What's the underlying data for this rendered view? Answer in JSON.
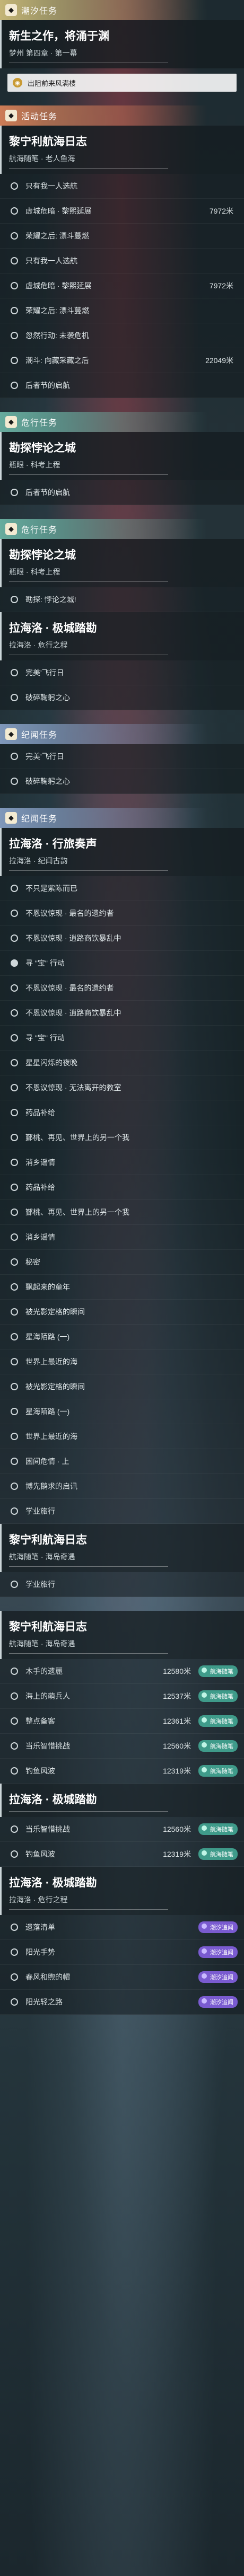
{
  "groups": [
    {
      "id": "g1",
      "header": "潮汐任务",
      "color": "#d6c47e",
      "icon": "tide-icon",
      "quests": [
        {
          "title": "新生之作，将涌于渊",
          "subtitle": "梦州 第四章 · 第一幕",
          "track_label": "出阻前来风满楼",
          "objectives": []
        }
      ]
    },
    {
      "id": "g2",
      "header": "活动任务",
      "color": "#e0855a",
      "icon": "event-icon",
      "quests": [
        {
          "title": "黎宁利航海日志",
          "subtitle": "航海随笔 · 老人鱼海",
          "objectives": [
            {
              "text": "只有我一人选航",
              "dist": "",
              "done": false,
              "tag": ""
            },
            {
              "text": "虚城危暗 · 黎熙延展",
              "dist": "7972米",
              "done": false,
              "tag": ""
            },
            {
              "text": "荣耀之后: 漂斗蔓燃",
              "dist": "",
              "done": false,
              "tag": ""
            }
          ]
        }
      ],
      "extra_objectives": [
        {
          "text": "只有我一人选航",
          "dist": "",
          "done": false,
          "tag": ""
        },
        {
          "text": "虚城危暗 · 黎熙延展",
          "dist": "7972米",
          "done": false,
          "tag": ""
        },
        {
          "text": "荣耀之后: 漂斗蔓燃",
          "dist": "",
          "done": false,
          "tag": ""
        },
        {
          "text": "忽然行动: 未袭危机",
          "dist": "",
          "done": false,
          "tag": ""
        },
        {
          "text": "潮斗: 向藏采藏之后",
          "dist": "22049米",
          "done": false,
          "tag": ""
        },
        {
          "text": "后者节的启航",
          "dist": "",
          "done": false,
          "tag": ""
        }
      ]
    },
    {
      "id": "g3",
      "header": "危行任务",
      "color": "#6fb9a9",
      "icon": "quest-icon",
      "quests": [
        {
          "title": "勘探悖论之城",
          "subtitle": "瓶眼 · 科考上程",
          "objectives": [
            {
              "text": "后者节的启航",
              "dist": "",
              "done": false,
              "tag": ""
            }
          ]
        }
      ]
    },
    {
      "id": "g4",
      "header": "危行任务",
      "color": "#6fb9a9",
      "icon": "quest-icon",
      "quests": [
        {
          "title": "勘探悖论之城",
          "subtitle": "瓶眼 · 科考上程",
          "objectives": [
            {
              "text": "勘探: 悖论之城!",
              "dist": "",
              "done": false,
              "tag": ""
            }
          ]
        },
        {
          "title": "拉海洛 · 极城踏勘",
          "subtitle": "拉海洛 · 危行之程",
          "objectives": [
            {
              "text": "完美'飞行日",
              "dist": "",
              "done": false,
              "tag": ""
            },
            {
              "text": "破碎鞠躬之心",
              "dist": "",
              "done": false,
              "tag": ""
            }
          ]
        }
      ]
    },
    {
      "id": "g5",
      "header": "纪闻任务",
      "color": "#8aa3c9",
      "icon": "record-icon",
      "quests": [],
      "extra_objectives": [
        {
          "text": "完美'飞行日",
          "dist": "",
          "done": false,
          "tag": ""
        },
        {
          "text": "破碎鞠躬之心",
          "dist": "",
          "done": false,
          "tag": ""
        }
      ]
    },
    {
      "id": "g6",
      "header": "纪闻任务",
      "color": "#8aa3c9",
      "icon": "record-icon",
      "quests": [
        {
          "title": "拉海洛 · 行旅奏声",
          "subtitle": "拉海洛 · 纪闻古韵",
          "objectives": [
            {
              "text": "不只是紫陈而已",
              "dist": "",
              "done": false,
              "tag": ""
            },
            {
              "text": "不恩议惊现 · 最名的遗约者",
              "dist": "",
              "done": false,
              "tag": ""
            },
            {
              "text": "不恩议惊现 · 逍路商饮暴乱中",
              "dist": "",
              "done": false,
              "tag": ""
            },
            {
              "text": "寻 \"宝\" 行动",
              "dist": "",
              "done": true,
              "tag": ""
            },
            {
              "text": "不恩议惊现 · 最名的遗约者",
              "dist": "",
              "done": false,
              "tag": ""
            },
            {
              "text": "不恩议惊现 · 逍路商饮暴乱中",
              "dist": "",
              "done": false,
              "tag": ""
            },
            {
              "text": "寻 \"宝\" 行动",
              "dist": "",
              "done": false,
              "tag": ""
            },
            {
              "text": "星星闪烁的夜晚",
              "dist": "",
              "done": false,
              "tag": ""
            },
            {
              "text": "不恩议惊现 · 无法离开的教室",
              "dist": "",
              "done": false,
              "tag": ""
            },
            {
              "text": "药品补给",
              "dist": "",
              "done": false,
              "tag": ""
            },
            {
              "text": "鄞桃、再见、世界上的另一个我",
              "dist": "",
              "done": false,
              "tag": ""
            },
            {
              "text": "消乡谣情",
              "dist": "",
              "done": false,
              "tag": ""
            },
            {
              "text": "药品补给",
              "dist": "",
              "done": false,
              "tag": ""
            },
            {
              "text": "鄞桃、再见、世界上的另一个我",
              "dist": "",
              "done": false,
              "tag": ""
            },
            {
              "text": "消乡谣情",
              "dist": "",
              "done": false,
              "tag": ""
            },
            {
              "text": "秘密",
              "dist": "",
              "done": false,
              "tag": ""
            },
            {
              "text": "飘起来的童年",
              "dist": "",
              "done": false,
              "tag": ""
            },
            {
              "text": "被光影定格的瞬间",
              "dist": "",
              "done": false,
              "tag": ""
            },
            {
              "text": "星海陌路 (一)",
              "dist": "",
              "done": false,
              "tag": ""
            },
            {
              "text": "世界上最近的海",
              "dist": "",
              "done": false,
              "tag": ""
            },
            {
              "text": "被光影定格的瞬间",
              "dist": "",
              "done": false,
              "tag": ""
            },
            {
              "text": "星海陌路 (一)",
              "dist": "",
              "done": false,
              "tag": ""
            },
            {
              "text": "世界上最近的海",
              "dist": "",
              "done": false,
              "tag": ""
            },
            {
              "text": "困间危情 · 上",
              "dist": "",
              "done": false,
              "tag": ""
            },
            {
              "text": "博先鹅求的启讯",
              "dist": "",
              "done": false,
              "tag": ""
            },
            {
              "text": "学业旅行",
              "dist": "",
              "done": false,
              "tag": ""
            }
          ]
        },
        {
          "title": "黎宁利航海日志",
          "subtitle": "航海随笔 · 海岛奇遇",
          "objectives": []
        }
      ],
      "extra_objectives": [
        {
          "text": "学业旅行",
          "dist": "",
          "done": false,
          "tag": ""
        }
      ]
    },
    {
      "id": "g7",
      "header": "",
      "color": "",
      "icon": "",
      "quests": [
        {
          "title": "黎宁利航海日志",
          "subtitle": "航海随笔 · 海岛奇遇",
          "objectives": [
            {
              "text": "木手的遗麗",
              "dist": "12580米",
              "done": false,
              "tag": "航海随笔",
              "tagc": "green"
            },
            {
              "text": "海上的萌兵人",
              "dist": "12537米",
              "done": false,
              "tag": "航海随笔",
              "tagc": "green"
            },
            {
              "text": "整点备客",
              "dist": "12361米",
              "done": false,
              "tag": "航海随笔",
              "tagc": "green"
            },
            {
              "text": "当乐智惜挑战",
              "dist": "12560米",
              "done": false,
              "tag": "航海随笔",
              "tagc": "green"
            },
            {
              "text": "钓鱼风波",
              "dist": "12319米",
              "done": false,
              "tag": "航海随笔",
              "tagc": "green"
            }
          ]
        },
        {
          "title": "拉海洛 · 极城踏勘",
          "subtitle": "",
          "objectives": [
            {
              "text": "当乐智惜挑战",
              "dist": "12560米",
              "done": false,
              "tag": "航海随笔",
              "tagc": "green"
            },
            {
              "text": "钓鱼风波",
              "dist": "12319米",
              "done": false,
              "tag": "航海随笔",
              "tagc": "green"
            }
          ]
        },
        {
          "title": "拉海洛 · 极城踏勘",
          "subtitle": "拉海洛 · 危行之程",
          "objectives": [
            {
              "text": "遗落清单",
              "dist": "",
              "done": false,
              "tag": "潮汐追闻",
              "tagc": "purple"
            },
            {
              "text": "阳光手势",
              "dist": "",
              "done": false,
              "tag": "潮汐追闻",
              "tagc": "purple"
            },
            {
              "text": "春风和煦的帽",
              "dist": "",
              "done": false,
              "tag": "潮汐追闻",
              "tagc": "purple"
            },
            {
              "text": "阳光轻之路",
              "dist": "",
              "done": false,
              "tag": "潮汐追闻",
              "tagc": "purple"
            }
          ]
        }
      ]
    }
  ]
}
